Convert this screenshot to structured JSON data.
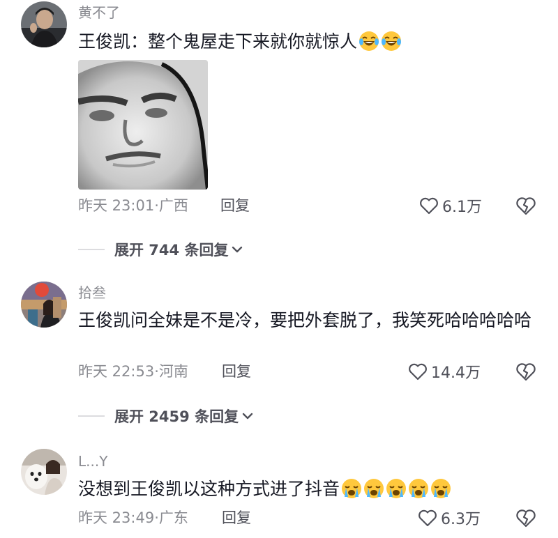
{
  "comments": [
    {
      "username": "黄不了",
      "text": "王俊凯：整个鬼屋走下来就你就惊人",
      "emoji_name": "laughing-tears-emoji",
      "emoji_count": 2,
      "time": "昨天 23:01·",
      "location": "广西",
      "reply_label": "回复",
      "likes": "6.1万",
      "expand_label": "展开 744 条回复"
    },
    {
      "username": "拾叁",
      "text": "王俊凯问全妹是不是冷，要把外套脱了，我笑死哈哈哈哈哈",
      "time": "昨天 22:53·",
      "location": "河南",
      "reply_label": "回复",
      "likes": "14.4万",
      "expand_label": "展开 2459 条回复"
    },
    {
      "username": "L...Y",
      "text": "没想到王俊凯以这种方式进了抖音",
      "emoji_name": "crying-emoji",
      "emoji_count": 5,
      "time": "昨天 23:49·",
      "location": "广东",
      "reply_label": "回复",
      "likes": "6.3万"
    }
  ],
  "colors": {
    "text_primary": "#161823",
    "text_secondary": "#8a8b91",
    "action": "#4f5059",
    "emoji_yellow": "#ffc83d"
  }
}
